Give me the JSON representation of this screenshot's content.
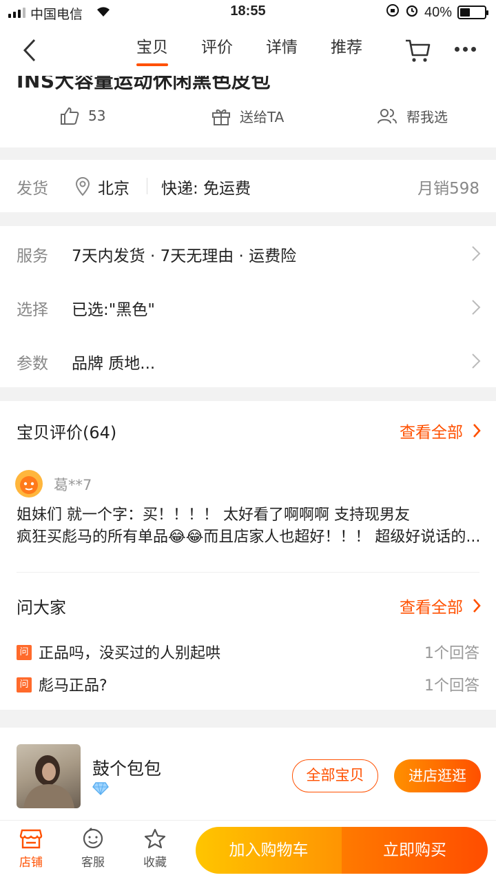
{
  "status_bar": {
    "carrier": "中国电信",
    "time": "18:55",
    "battery_percent": "40%",
    "battery_level": 0.4
  },
  "nav": {
    "tabs": [
      "宝贝",
      "评价",
      "详情",
      "推荐"
    ],
    "active_tab": "宝贝"
  },
  "product": {
    "title_partial": "INS大容量运动休闲黑色皮包",
    "likes": "53",
    "gift_label": "送给TA",
    "help_choose_label": "帮我选"
  },
  "shipping": {
    "label": "发货",
    "location": "北京",
    "express": "快递: 免运费",
    "monthly_sales": "月销598"
  },
  "options": [
    {
      "key": "服务",
      "value": "7天内发货 · 7天无理由 · 运费险"
    },
    {
      "key": "选择",
      "value": "已选:\"黑色\""
    },
    {
      "key": "参数",
      "value": "品牌 质地..."
    }
  ],
  "reviews": {
    "title": "宝贝评价(64)",
    "see_all": "查看全部",
    "reviewer": "葛**7",
    "text_line1": "姐妹们 就一个字：买！！！！ 太好看了啊啊啊 支持现男友",
    "text_line2": "疯狂买彪马的所有单品😂😂而且店家人也超好！！！ 超级好说话的..."
  },
  "qa": {
    "title": "问大家",
    "see_all": "查看全部",
    "badge": "问",
    "items": [
      {
        "question": "正品吗，没买过的人别起哄",
        "answers": "1个回答"
      },
      {
        "question": "彪马正品?",
        "answers": "1个回答"
      }
    ]
  },
  "shop": {
    "name": "鼓个包包",
    "all_items": "全部宝贝",
    "enter": "进店逛逛"
  },
  "bottom_bar": {
    "shop": "店铺",
    "service": "客服",
    "favorite": "收藏",
    "add_cart": "加入购物车",
    "buy_now": "立即购买"
  },
  "colors": {
    "accent": "#ff5000",
    "cart_yellow": "#ffc500",
    "buy_orange": "#ff4d00"
  }
}
